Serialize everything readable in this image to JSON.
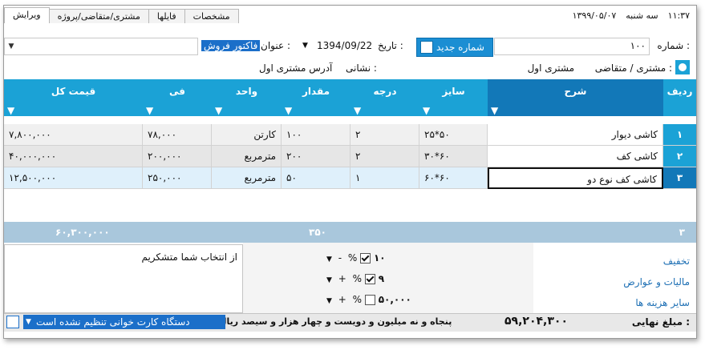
{
  "header": {
    "time": "۱۱:۳۷",
    "weekday": "سه شنبه",
    "date": "۱۳۹۹/۰۵/۰۷",
    "tabs": [
      "ویرایش",
      "مشتری/متقاضی/پروژه",
      "فایلها",
      "مشخصات"
    ]
  },
  "form": {
    "number_label": "شماره :",
    "number_value": "۱۰۰",
    "new_number_button": "شماره جدید",
    "date_label": "تاریخ :",
    "date_value": "1394/09/22",
    "title_label": "عنوان :",
    "title_value": "فاکتور فروش",
    "customer_label": "مشتری / متقاضی :",
    "customer_value": "مشتری اول",
    "address_label": "نشانی :",
    "address_value": "آدرس مشتری اول"
  },
  "table": {
    "columns": [
      "ردیف",
      "شرح",
      "سایز",
      "درجه",
      "مقدار",
      "واحد",
      "فی",
      "قیمت کل"
    ],
    "rows": [
      [
        "۱",
        "کاشی دیوار",
        "۲۵*۵۰",
        "۲",
        "۱۰۰",
        "کارتن",
        "۷۸,۰۰۰",
        "۷,۸۰۰,۰۰۰"
      ],
      [
        "۲",
        "کاشی کف",
        "۳۰*۶۰",
        "۲",
        "۲۰۰",
        "مترمربع",
        "۲۰۰,۰۰۰",
        "۴۰,۰۰۰,۰۰۰"
      ],
      [
        "۳",
        "کاشی کف نوع دو",
        "۶۰*۶۰",
        "۱",
        "۵۰",
        "مترمربع",
        "۲۵۰,۰۰۰",
        "۱۲,۵۰۰,۰۰۰"
      ]
    ],
    "footer": {
      "count": "۳",
      "quantity_total": "۳۵۰",
      "price_total": "۶۰,۳۰۰,۰۰۰"
    }
  },
  "adjustments": {
    "discount_label": "تخفیف",
    "discount_value": "۱۰",
    "tax_label": "مالیات و عوارض",
    "tax_value": "۹",
    "other_label": "سایر هزینه ها",
    "other_value": "۵۰,۰۰۰",
    "percent": "%",
    "minus": "-",
    "plus": "+"
  },
  "note": "از انتخاب شما متشکریم",
  "status": {
    "final_label": "مبلغ نهایی :",
    "final_value": "۵۹,۲۰۴,۳۰۰",
    "words": "پنجاه و نه میلیون و دویست و چهار هزار و سیصد ریال",
    "card_reader": "دستگاه کارت خوانی تنظیم نشده است"
  },
  "colors": {
    "header_blue": "#1ba2d6",
    "selected_blue": "#1278b8",
    "button_blue": "#1b8ed3"
  }
}
